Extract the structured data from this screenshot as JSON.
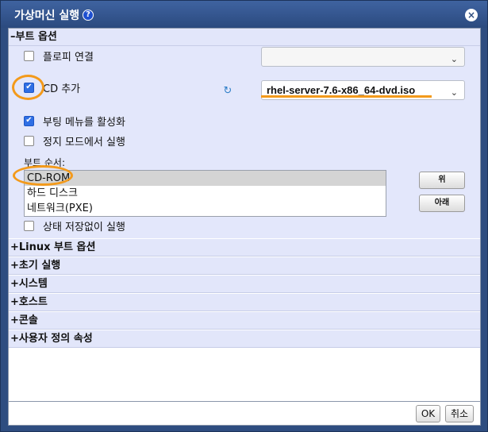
{
  "dialog": {
    "title": "가상머신 실행",
    "help_glyph": "?",
    "close_glyph": "×"
  },
  "boot_options": {
    "header": "–부트 옵션",
    "floppy": {
      "label": "플로피 연결",
      "checked": false
    },
    "cd": {
      "label": "CD 추가",
      "checked": true
    },
    "iso_select": {
      "value": "rhel-server-7.6-x86_64-dvd.iso"
    },
    "boot_menu": {
      "label": "부팅 메뉴를 활성화",
      "checked": true
    },
    "pause_mode": {
      "label": "정지 모드에서 실행",
      "checked": false
    },
    "boot_order_label": "부트 순서:",
    "boot_order": [
      "CD-ROM",
      "하드 디스크",
      "네트워크(PXE)"
    ],
    "boot_order_selected": "CD-ROM",
    "up_button": "위",
    "down_button": "아래",
    "stateless": {
      "label": "상태 저장없이 실행",
      "checked": false
    }
  },
  "sections": [
    {
      "label": "+Linux 부트 옵션"
    },
    {
      "label": "+초기 실행"
    },
    {
      "label": "+시스템"
    },
    {
      "label": "+호스트"
    },
    {
      "label": "+콘솔"
    },
    {
      "label": "+사용자 정의 속성"
    }
  ],
  "footer": {
    "ok_label": "OK",
    "cancel_label": "취소"
  },
  "icons": {
    "refresh": "refresh-icon",
    "dropdown": "chevron-down-icon",
    "check": "checkmark-icon"
  },
  "colors": {
    "title_bar": "#2e4d80",
    "panel": "#e3e7fb",
    "annotation": "#f39a1b",
    "checkbox_checked": "#2f6fe4"
  }
}
